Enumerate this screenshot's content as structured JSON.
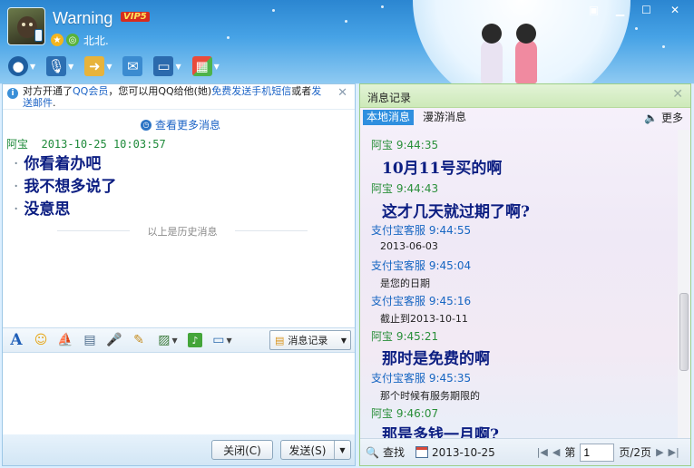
{
  "window": {
    "nickname": "Warning",
    "vip_badge": "VIP5",
    "location": "北北.",
    "colors": {
      "titlebar": "#2b86d1",
      "accent": "#1b63c6",
      "sender_green": "#2a8f3a",
      "service_blue": "#1766c2",
      "message_navy": "#0c1e82"
    }
  },
  "toolbar": {
    "icons": [
      "video-icon",
      "voice-icon",
      "file-transfer-icon",
      "sms-icon",
      "screen-share-icon",
      "apps-icon"
    ]
  },
  "notice": {
    "text_before": "对方开通了",
    "link_vip": "QQ会员",
    "text_middle": "，您可以用QQ给他(她)",
    "link_sms": "免费发送手机短信",
    "text_or": "或者",
    "link_email": "发送邮件",
    "text_end": "."
  },
  "chat": {
    "view_more": "查看更多消息",
    "sender": "阿宝",
    "timestamp": "2013-10-25 10:03:57",
    "lines": [
      "你看着办吧",
      "我不想多说了",
      "没意思"
    ],
    "history_separator": "以上是历史消息"
  },
  "input_toolbar": {
    "record_button": "消息记录"
  },
  "buttons": {
    "close": "关闭(C)",
    "send": "发送(S)"
  },
  "history": {
    "title": "消息记录",
    "tabs": [
      "本地消息",
      "漫游消息"
    ],
    "more": "更多",
    "entries": [
      {
        "sender": "阿宝",
        "time": "9:44:35",
        "text": "10月11号买的啊",
        "big": true
      },
      {
        "sender": "阿宝",
        "time": "9:44:43",
        "text": "这才几天就过期了啊?",
        "big": true
      },
      {
        "sender": "支付宝客服",
        "time": "9:44:55",
        "text": "2013-06-03",
        "big": false
      },
      {
        "sender": "支付宝客服",
        "time": "9:45:04",
        "text": "是您的日期",
        "big": false
      },
      {
        "sender": "支付宝客服",
        "time": "9:45:16",
        "text": "截止到2013-10-11",
        "big": false
      },
      {
        "sender": "阿宝",
        "time": "9:45:21",
        "text": "那时是免费的啊",
        "big": true
      },
      {
        "sender": "支付宝客服",
        "time": "9:45:35",
        "text": "那个时候有服务期限的",
        "big": false
      },
      {
        "sender": "阿宝",
        "time": "9:46:07",
        "text": "那是多钱一月啊?",
        "big": true
      }
    ],
    "footer": {
      "search": "查找",
      "date": "2013-10-25",
      "page_label": "第",
      "page_value": "1",
      "page_total": "页/2页"
    }
  }
}
